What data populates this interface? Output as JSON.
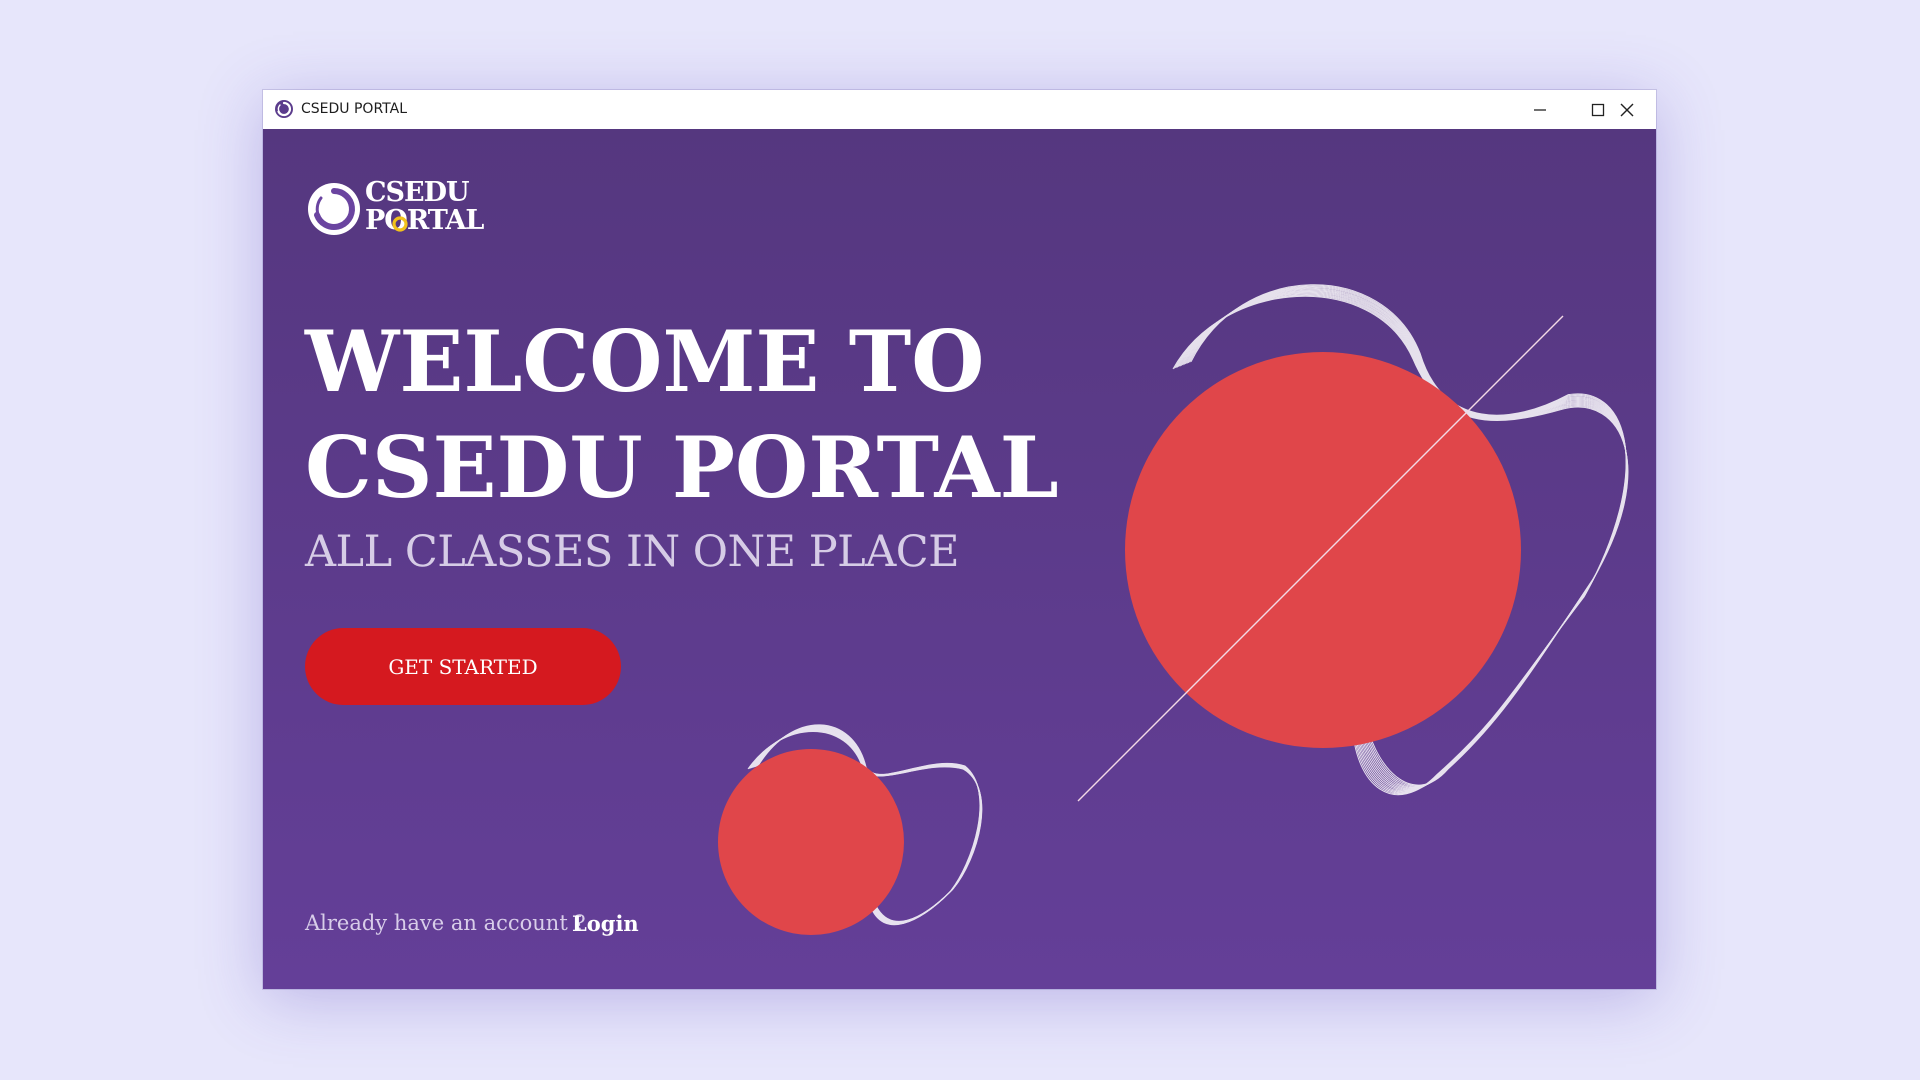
{
  "window": {
    "title": "CSEDU PORTAL",
    "app_icon": "csedu-swirl-icon",
    "controls": {
      "minimize_icon": "minimize-icon",
      "maximize_icon": "maximize-icon",
      "close_icon": "close-icon"
    }
  },
  "brand": {
    "logo_line1": "CSEDU",
    "logo_line2": "PORTAL",
    "logo_icon": "csedu-swirl-logo"
  },
  "hero": {
    "headline_line1": "WELCOME TO",
    "headline_line2": "CSEDU PORTAL",
    "tagline": "ALL CLASSES IN ONE PLACE",
    "cta_label": "GET STARTED"
  },
  "footer": {
    "account_prompt": "Already have an account ?",
    "login_label": "Login"
  },
  "colors": {
    "background_top": "#55377f",
    "background_bottom": "#643f98",
    "cta": "#d5191f",
    "circle": "#e0464a",
    "logo_accent": "#f2c21b"
  }
}
